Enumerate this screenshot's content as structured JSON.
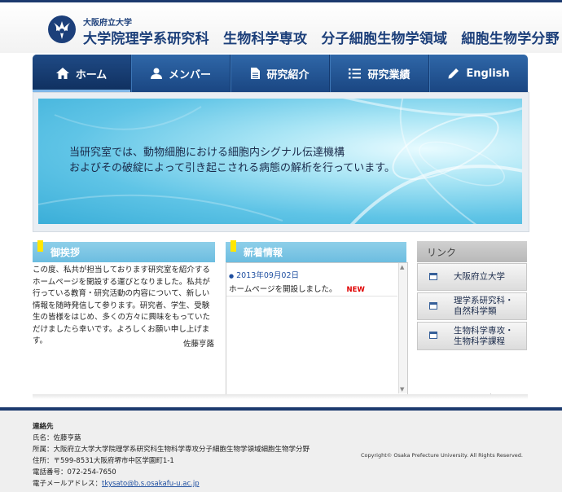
{
  "header": {
    "university": "大阪府立大学",
    "title": "大学院理学系研究科　生物科学専攻　分子細胞生物学領域　細胞生物学分野"
  },
  "nav": [
    {
      "label": "ホーム",
      "icon": "home-icon"
    },
    {
      "label": "メンバー",
      "icon": "person-icon"
    },
    {
      "label": "研究紹介",
      "icon": "document-icon"
    },
    {
      "label": "研究業績",
      "icon": "list-icon"
    },
    {
      "label": "English",
      "icon": "pencil-icon"
    }
  ],
  "hero": {
    "line1": "当研究室では、動物細胞における細胞内シグナル伝達機構",
    "line2": "およびその破綻によって引き起こされる病態の解析を行っています。"
  },
  "greeting": {
    "heading": "御挨拶",
    "body": "この度、私共が担当しております研究室を紹介するホームページを開設する運びとなりました。私共が行っている教育・研究活動の内容について、新しい情報を随時発信して参ります。研究者、学生、受験生の皆様をはじめ、多くの方々に興味をもっていただけましたら幸いです。よろしくお願い申し上げます。",
    "signature": "佐藤亨蕗"
  },
  "news": {
    "heading": "新着情報",
    "items": [
      {
        "date": "2013年09月02日",
        "text": "ホームページを開設しました。",
        "badge": "NEW"
      }
    ]
  },
  "links": {
    "heading": "リンク",
    "items": [
      {
        "label": "大阪府立大学"
      },
      {
        "label": "理学系研究科・自然科学類"
      },
      {
        "label": "生物科学専攻・生物科学課程"
      }
    ]
  },
  "footer": {
    "contact_label": "連絡先",
    "name": "氏名：佐藤亨蕗",
    "affiliation": "所属：大阪府立大学大学院理学系研究科生物科学専攻分子細胞生物学領域細胞生物学分野",
    "address": "住所：〒599-8531大阪府堺市中区学園町1-1",
    "phone": "電話番号：072-254-7650",
    "email_label": "電子メールアドレス：",
    "email": "tkysato@b.s.osakafu-u.ac.jp",
    "copyright": "Copyright© Osaka Prefecture University. All Rights Reserved."
  },
  "colors": {
    "nav": "#1f4f8e",
    "news_date": "#1f4fa0",
    "new_badge": "#e00000",
    "accent_flag": "#ffe600"
  }
}
